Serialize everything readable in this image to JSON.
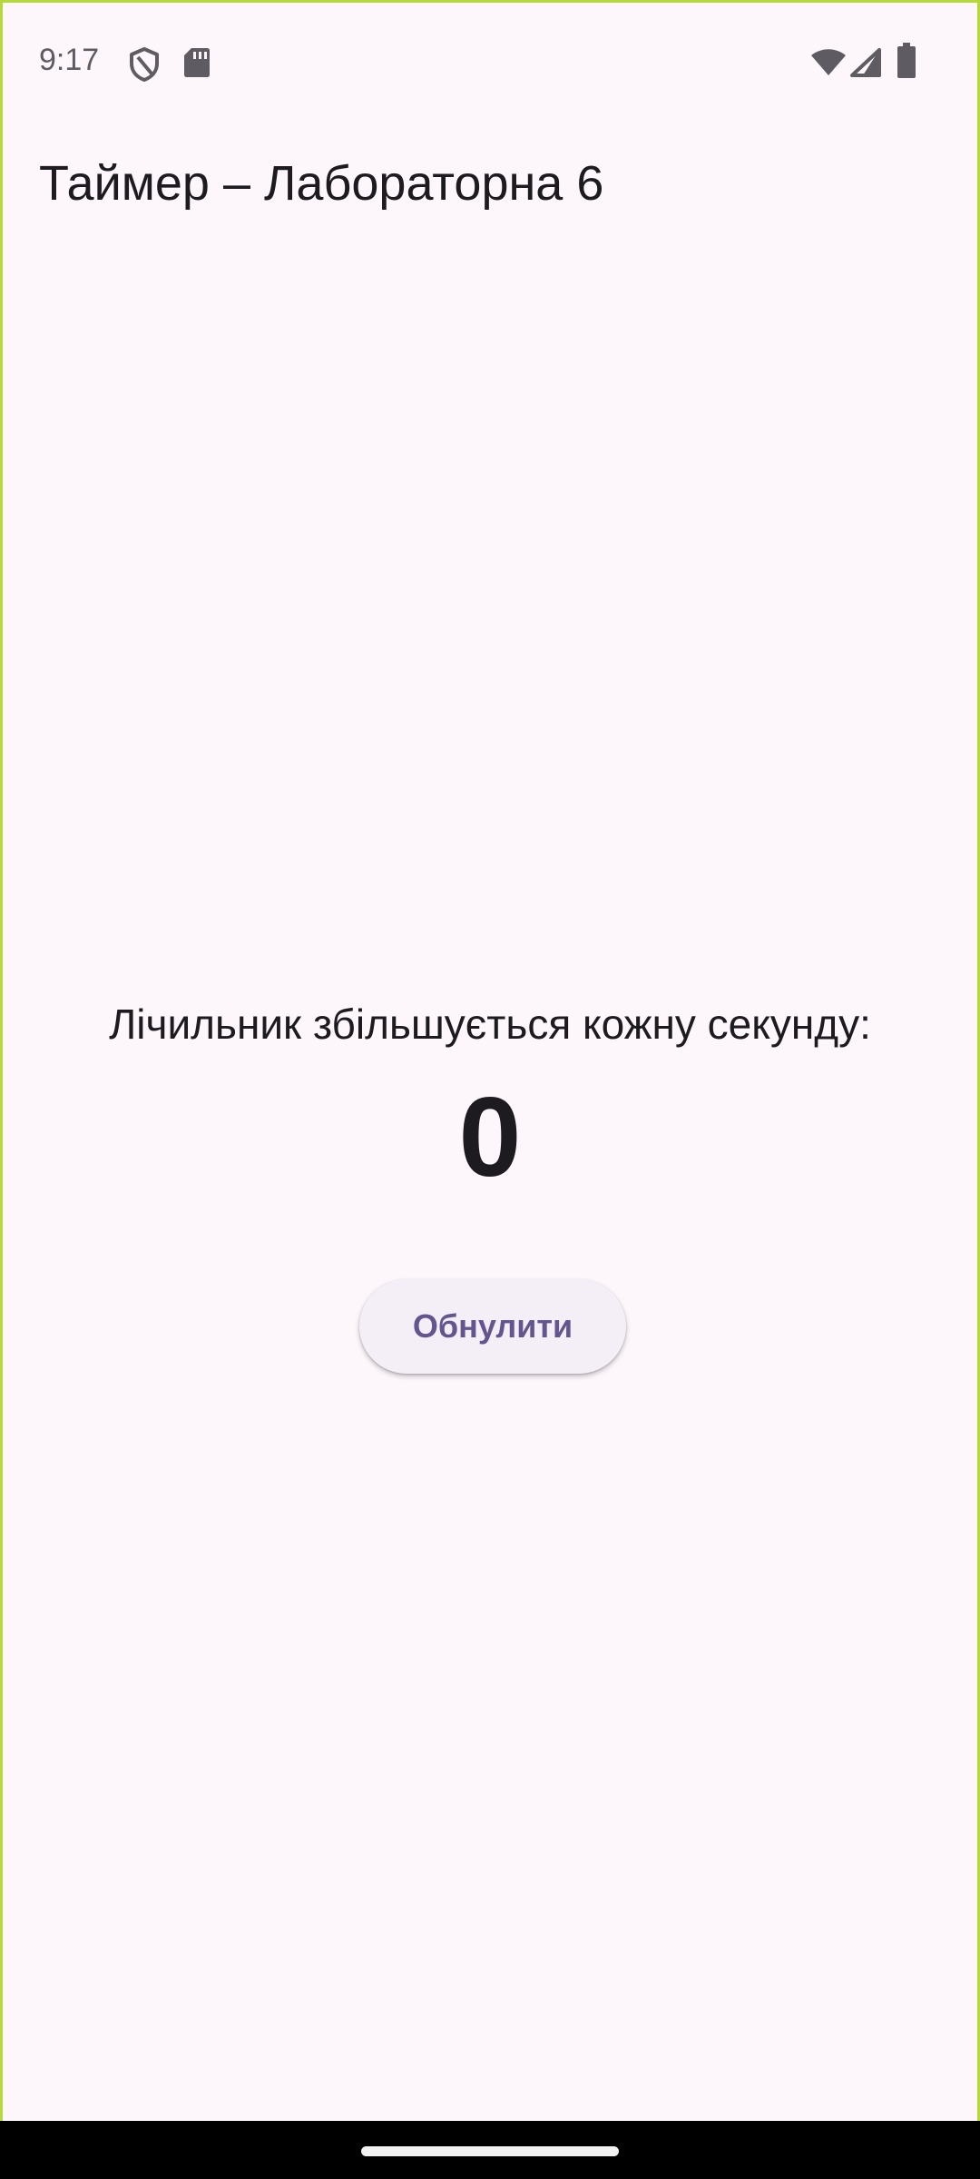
{
  "status_bar": {
    "time": "9:17",
    "icons": [
      "shield-icon",
      "sd-card-icon",
      "wifi-icon",
      "signal-icon",
      "battery-icon"
    ]
  },
  "app_bar": {
    "title": "Таймер – Лабораторна 6"
  },
  "main": {
    "counter_label": "Лічильник збільшується кожну секунду:",
    "counter_value": "0",
    "reset_button_label": "Обнулити"
  },
  "colors": {
    "background": "#fdf7fc",
    "text": "#1d1b20",
    "accent": "#65558f",
    "button_bg": "#f4eff6",
    "frame_border": "#b6d93a"
  }
}
